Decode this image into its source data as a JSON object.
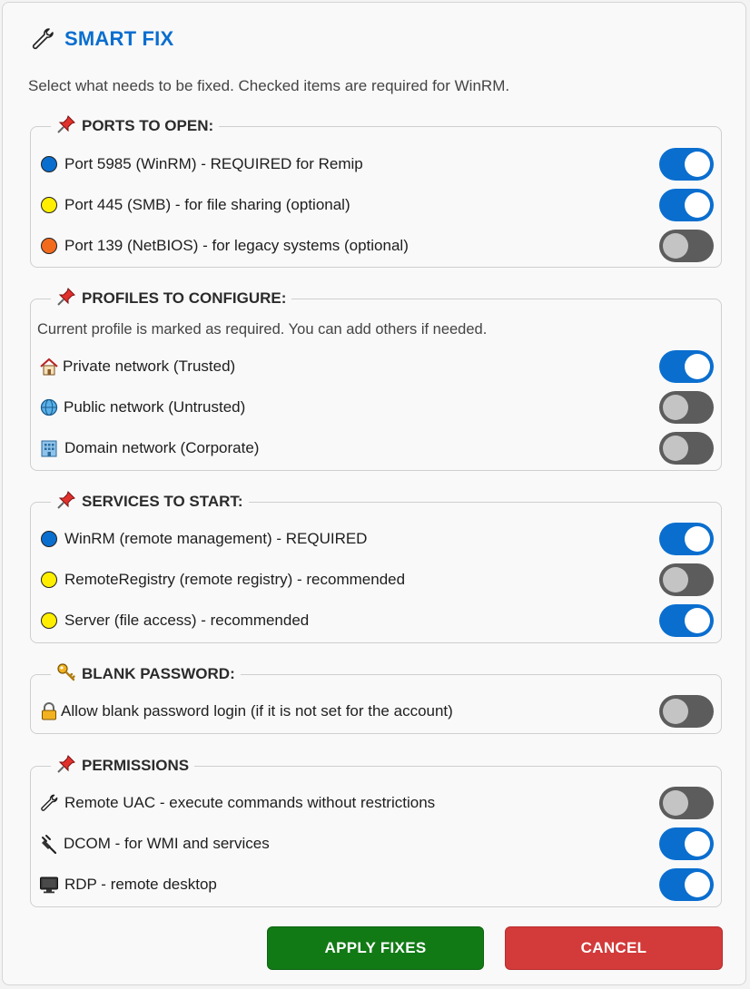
{
  "dialog": {
    "title": "SMART FIX",
    "title_icon": "wrench-icon",
    "subtitle": "Select what needs to be fixed. Checked items are required for WinRM."
  },
  "colors": {
    "accent": "#0a6ecf",
    "toggle_on": "#0a6ecf",
    "toggle_off": "#5c5c5c",
    "apply": "#117a15",
    "cancel": "#d33a3a",
    "dot_blue": "#0a6ecf",
    "dot_yellow": "#ffee00",
    "dot_orange": "#f26b1d"
  },
  "groups": [
    {
      "title": "PORTS TO OPEN:",
      "icon": "pushpin-icon",
      "items": [
        {
          "icon": "blue-circle-icon",
          "label": "Port 5985 (WinRM) - REQUIRED for Remip",
          "checked": true
        },
        {
          "icon": "yellow-circle-icon",
          "label": "Port 445 (SMB) - for file sharing (optional)",
          "checked": true
        },
        {
          "icon": "orange-circle-icon",
          "label": "Port 139 (NetBIOS) - for legacy systems (optional)",
          "checked": false
        }
      ]
    },
    {
      "title": "PROFILES TO CONFIGURE:",
      "icon": "pushpin-icon",
      "note": "Current profile is marked as required. You can add others if needed.",
      "items": [
        {
          "icon": "house-icon",
          "label": "Private network (Trusted)",
          "checked": true
        },
        {
          "icon": "globe-icon",
          "label": "Public network (Untrusted)",
          "checked": false
        },
        {
          "icon": "office-building-icon",
          "label": "Domain network (Corporate)",
          "checked": false
        }
      ]
    },
    {
      "title": "SERVICES TO START:",
      "icon": "pushpin-icon",
      "items": [
        {
          "icon": "blue-circle-icon",
          "label": "WinRM (remote management) - REQUIRED",
          "checked": true
        },
        {
          "icon": "yellow-circle-icon",
          "label": "RemoteRegistry (remote registry) - recommended",
          "checked": false
        },
        {
          "icon": "yellow-circle-icon",
          "label": "Server (file access) - recommended",
          "checked": true
        }
      ]
    },
    {
      "title": "BLANK PASSWORD:",
      "icon": "key-icon",
      "items": [
        {
          "icon": "lock-icon",
          "label": "Allow blank password login (if it is not set for the account)",
          "checked": false
        }
      ]
    },
    {
      "title": "PERMISSIONS",
      "icon": "pushpin-icon",
      "items": [
        {
          "icon": "wrench-icon",
          "label": "Remote UAC - execute commands without restrictions",
          "checked": false
        },
        {
          "icon": "plug-icon",
          "label": "DCOM - for WMI and services",
          "checked": true
        },
        {
          "icon": "monitor-icon",
          "label": "RDP - remote desktop",
          "checked": true
        }
      ]
    }
  ],
  "buttons": {
    "apply": "APPLY FIXES",
    "cancel": "CANCEL"
  }
}
